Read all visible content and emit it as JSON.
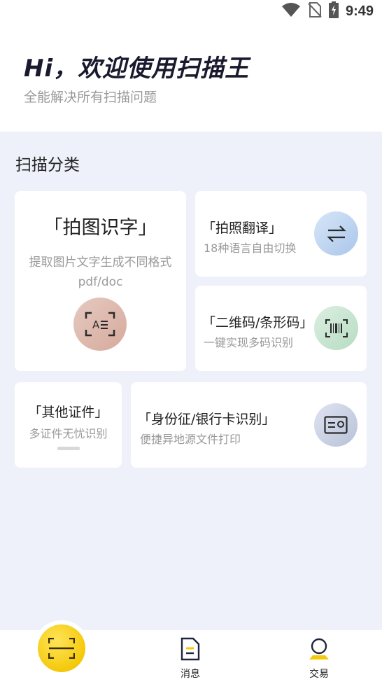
{
  "status_bar": {
    "time": "9:49",
    "icons": [
      "wifi-icon",
      "no-sim-icon",
      "battery-charging-icon"
    ]
  },
  "header": {
    "greeting": "Hi，欢迎使用扫描王",
    "subtitle": "全能解决所有扫描问题"
  },
  "main": {
    "section_title": "扫描分类",
    "cards": {
      "photo_text": {
        "title": "「拍图识字」",
        "desc": "提取图片文字生成不同格式pdf/doc",
        "icon": "text-scan-icon"
      },
      "photo_translate": {
        "title": "「拍照翻译」",
        "desc": "18种语言自由切换",
        "icon": "swap-arrows-icon"
      },
      "qr_barcode": {
        "title": "「二维码/条形码」",
        "desc": "一键实现多码识别",
        "icon": "barcode-scan-icon"
      },
      "other_docs": {
        "title": "「其他证件」",
        "desc": "多证件无忧识别"
      },
      "id_bank": {
        "title": "「身份征/银行卡识别」",
        "desc": "便捷异地源文件打印",
        "icon": "id-card-icon"
      }
    }
  },
  "bottom_nav": {
    "scan_icon": "scan-icon",
    "messages_label": "消息",
    "trade_label": "交易"
  },
  "colors": {
    "accent_yellow": "#f4c90c",
    "background": "#eef1fa"
  }
}
